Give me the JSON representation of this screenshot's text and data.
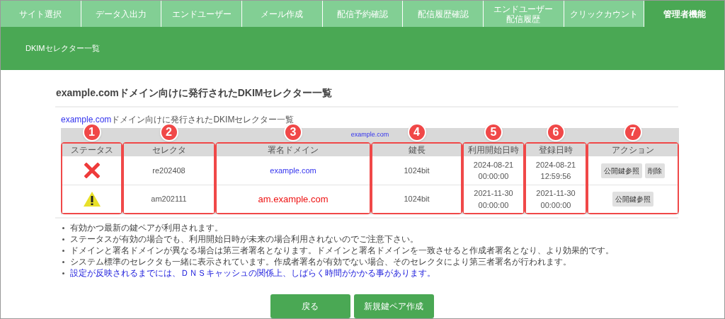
{
  "nav_tabs": [
    {
      "label": "サイト選択",
      "selected": false
    },
    {
      "label": "データ入出力",
      "selected": false
    },
    {
      "label": "エンドユーザー",
      "selected": false
    },
    {
      "label": "メール作成",
      "selected": false
    },
    {
      "label": "配信予約確認",
      "selected": false
    },
    {
      "label": "配信履歴確認",
      "selected": false
    },
    {
      "label": "エンドユーザー",
      "label_line_2": "配信履歴",
      "selected": false
    },
    {
      "label": "クリックカウント",
      "selected": false
    },
    {
      "label": "管理者機能",
      "selected": true
    }
  ],
  "subheader": "DKIMセレクター一覧",
  "heading": "example.comドメイン向けに発行されたDKIMセレクター一覧",
  "caption": {
    "link": "example.com",
    "text": "ドメイン向けに発行されたDKIMセレクター一覧"
  },
  "table": {
    "caption_label": "example.com",
    "columns": [
      {
        "label": "ステータス",
        "callout": "1"
      },
      {
        "label": "セレクタ",
        "callout": "2"
      },
      {
        "label": "署名ドメイン",
        "callout": "3"
      },
      {
        "label": "鍵長",
        "callout": "4"
      },
      {
        "label": "利用開始日時",
        "callout": "5"
      },
      {
        "label": "登録日時",
        "callout": "6"
      },
      {
        "label": "アクション",
        "callout": "7"
      }
    ],
    "rows": [
      {
        "kind": "invalid",
        "selector": "re202408",
        "signing_domain": {
          "text": "example.com",
          "kind": "match"
        },
        "key_length": "1024bit",
        "start": {
          "date": "2024-08-21",
          "time": "00:00:00"
        },
        "registered": {
          "date": "2024-08-21",
          "time": "12:59:56"
        },
        "actions": [
          "公開鍵参照",
          "削除"
        ]
      },
      {
        "kind": "warning",
        "selector": "am202111",
        "signing_domain": {
          "text": "am.example.com",
          "kind": "mismatch"
        },
        "key_length": "1024bit",
        "start": {
          "date": "2021-11-30",
          "time": "00:00:00"
        },
        "registered": {
          "date": "2021-11-30",
          "time": "00:00:00"
        },
        "actions": [
          "公開鍵参照"
        ]
      }
    ]
  },
  "notes": [
    {
      "text": "有効かつ最新の鍵ペアが利用されます。",
      "kind": "normal"
    },
    {
      "text": "ステータスが有効の場合でも、利用開始日時が未来の場合利用されないのでご注意下さい。",
      "kind": "normal"
    },
    {
      "text": "ドメインと署名ドメインが異なる場合は第三者署名となります。ドメインと署名ドメインを一致させると作成者署名となり、より効果的です。",
      "kind": "normal"
    },
    {
      "text": "システム標準のセレクタも一緒に表示されています。作成者署名が有効でない場合、そのセレクタにより第三者署名が行われます。",
      "kind": "normal"
    },
    {
      "text": "設定が反映されるまでには、ＤＮＳキャッシュの関係上、しばらく時間がかかる事があります。",
      "kind": "info"
    }
  ],
  "buttons": [
    "戻る",
    "新規鍵ペア作成"
  ]
}
